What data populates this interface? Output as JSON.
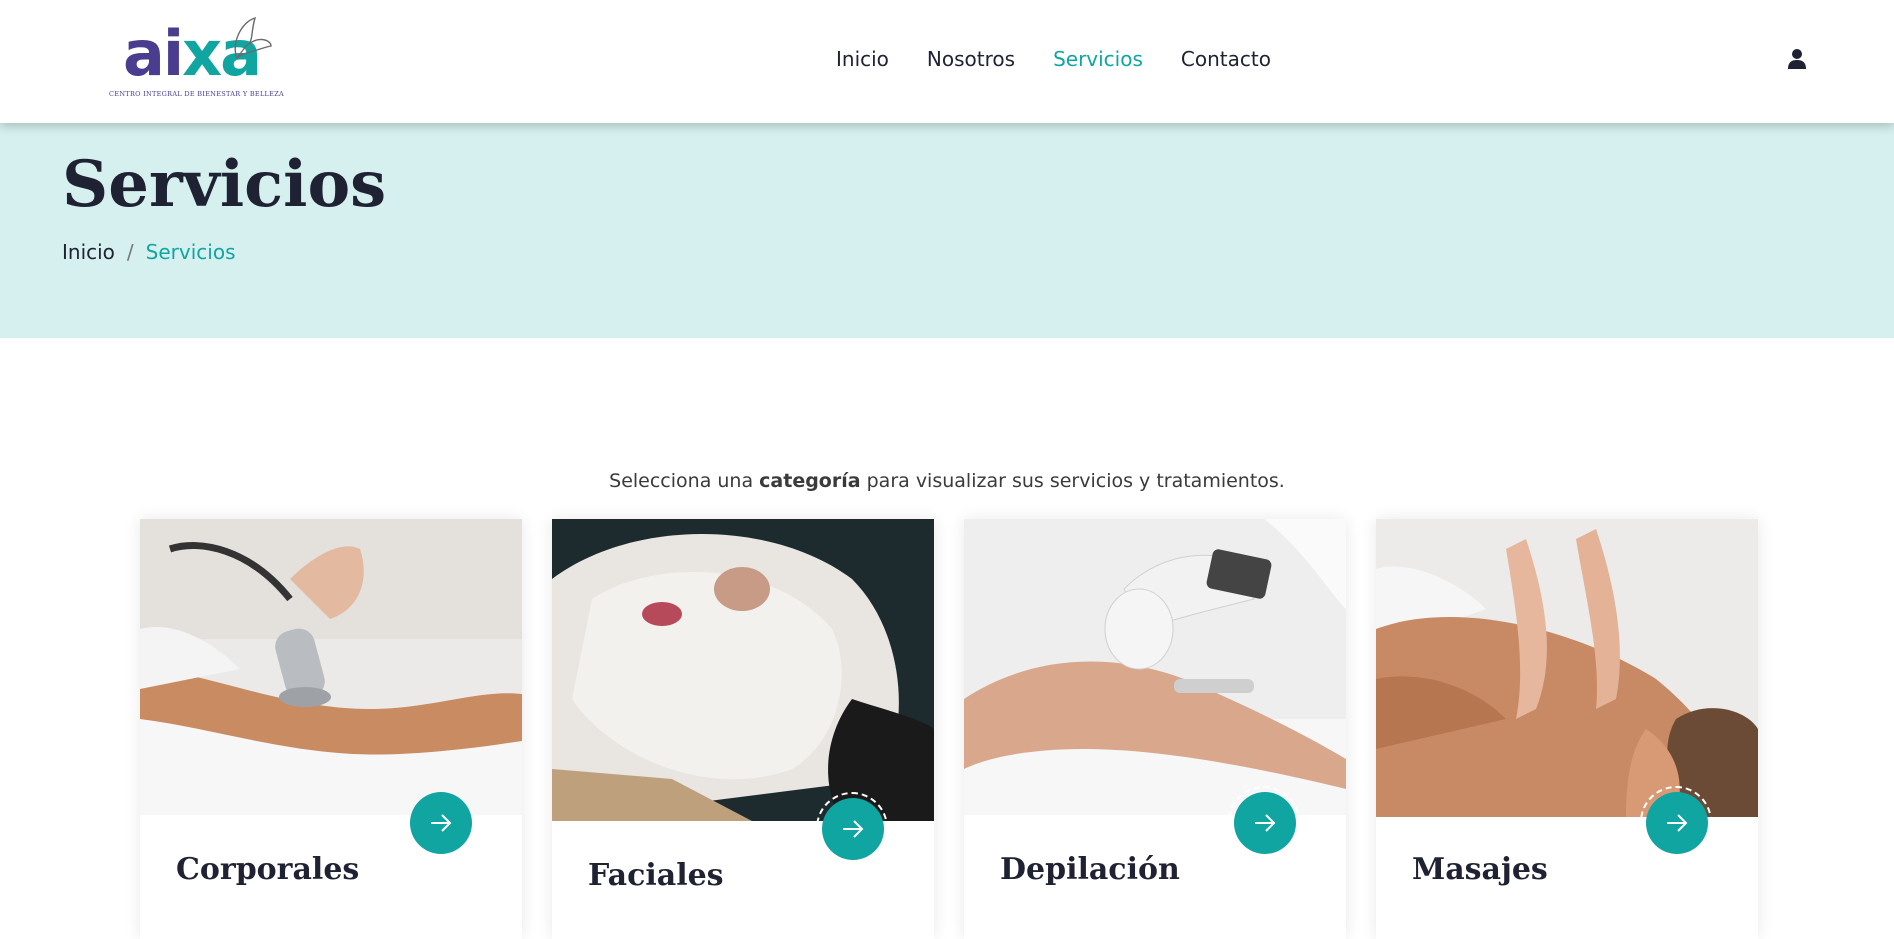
{
  "brand": {
    "logo_letters_a": "a",
    "logo_letters_rest_1": "i",
    "logo_letters_rest_2": "xa",
    "tagline": "Centro integral de bienestar y belleza",
    "colors": {
      "primary": "#11a5a2",
      "logo_purple": "#4a3c8f",
      "dark_text": "#1f2233",
      "banner_bg": "#d6f0ef"
    }
  },
  "nav": {
    "items": [
      {
        "label": "Inicio",
        "active": false
      },
      {
        "label": "Nosotros",
        "active": false
      },
      {
        "label": "Servicios",
        "active": true
      },
      {
        "label": "Contacto",
        "active": false
      }
    ],
    "user_icon": "user-icon"
  },
  "banner": {
    "title": "Servicios",
    "breadcrumb": {
      "home": "Inicio",
      "separator": "/",
      "current": "Servicios"
    }
  },
  "intro": {
    "before": "Selecciona una ",
    "bold": "categoría",
    "after": " para visualizar sus servicios y tratamientos."
  },
  "categories": [
    {
      "title": "Corporales",
      "image": "body treatment photo",
      "button_icon": "arrow-right-icon"
    },
    {
      "title": "Faciales",
      "image": "facial mask photo",
      "button_icon": "arrow-right-icon"
    },
    {
      "title": "Depilación",
      "image": "laser hair removal photo",
      "button_icon": "arrow-right-icon"
    },
    {
      "title": "Masajes",
      "image": "back massage photo",
      "button_icon": "arrow-right-icon"
    }
  ]
}
